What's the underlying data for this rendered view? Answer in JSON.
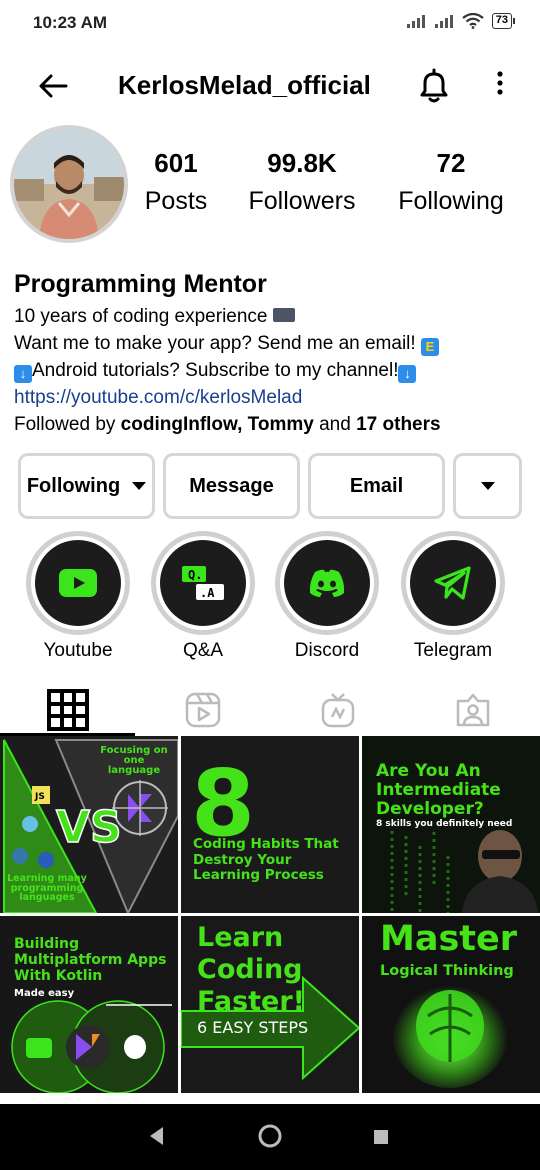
{
  "status_bar": {
    "time": "10:23 AM",
    "battery": "73"
  },
  "header": {
    "username": "KerlosMelad_official"
  },
  "stats": [
    {
      "value": "601",
      "label": "Posts"
    },
    {
      "value": "99.8K",
      "label": "Followers"
    },
    {
      "value": "72",
      "label": "Following"
    }
  ],
  "bio": {
    "name": "Programming Mentor",
    "line1": "10 years of coding experience",
    "line2": "Want me to make your app? Send me an email!",
    "line3": "Android tutorials? Subscribe to my channel!",
    "link": "https://youtube.com/c/kerlosMelad",
    "followed_prefix": "Followed by ",
    "followed_names": "codingInflow, Tommy",
    "followed_and": " and ",
    "followed_others": "17 others"
  },
  "actions": {
    "following": "Following",
    "message": "Message",
    "email": "Email"
  },
  "highlights": [
    {
      "label": "Youtube",
      "icon": "youtube-icon"
    },
    {
      "label": "Q&A",
      "icon": "qa-icon"
    },
    {
      "label": "Discord",
      "icon": "discord-icon"
    },
    {
      "label": "Telegram",
      "icon": "telegram-icon"
    }
  ],
  "tabs": [
    "grid-icon",
    "reels-icon",
    "igtv-icon",
    "tagged-icon"
  ],
  "posts": {
    "p1": {
      "top": "Focusing on one language",
      "vs": "VS",
      "bottom": "Learning many programming languages"
    },
    "p2": {
      "big": "8",
      "text": "Coding Habits That Destroy Your Learning Process"
    },
    "p3": {
      "title": "Are You An Intermediate Developer?",
      "sub": "8 skills you definitely need"
    },
    "p4": {
      "title": "Building Multiplatform Apps With Kotlin",
      "sub": "Made easy"
    },
    "p5": {
      "title": "Learn Coding Faster!",
      "sub": "6 EASY STEPS"
    },
    "p6": {
      "title": "Master",
      "sub": "Logical Thinking"
    }
  },
  "colors": {
    "accent_green": "#45e21a",
    "link_blue": "#1a3f8f",
    "tile_bg": "#161616"
  }
}
